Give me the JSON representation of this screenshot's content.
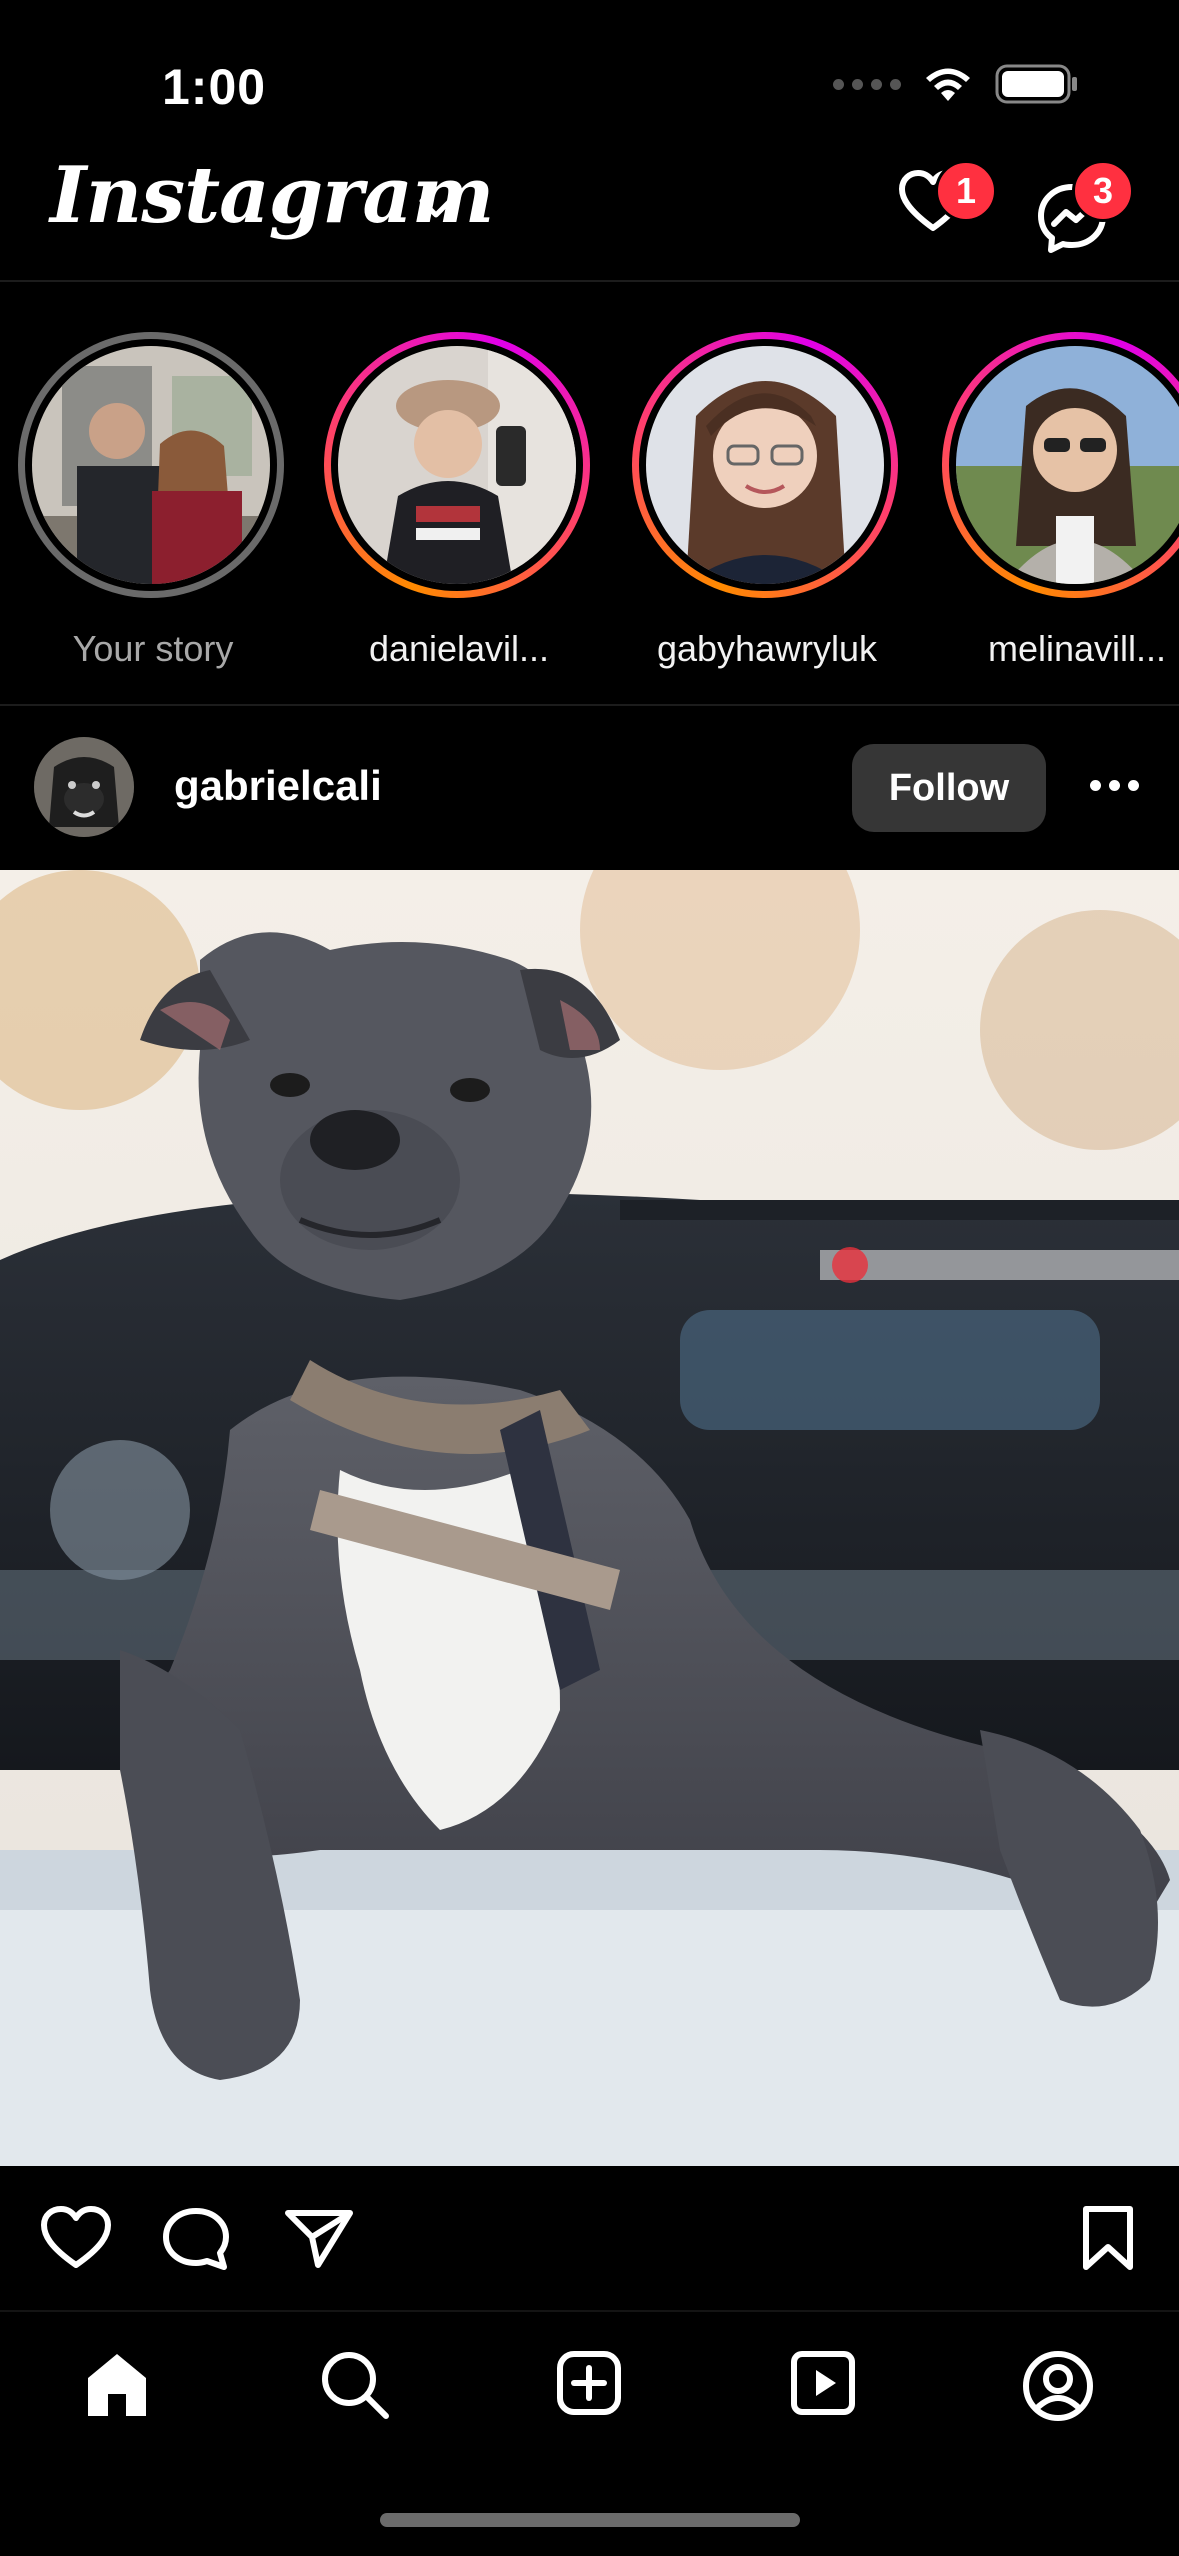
{
  "status_bar": {
    "time": "1:00"
  },
  "header": {
    "logo_text": "Instagram",
    "notifications_count": "1",
    "messages_count": "3"
  },
  "stories": [
    {
      "label": "Your story",
      "seen": true
    },
    {
      "label": "danielavil...",
      "seen": false
    },
    {
      "label": "gabyhawryluk",
      "seen": false
    },
    {
      "label": "melinavill...",
      "seen": false
    }
  ],
  "post": {
    "username": "gabrielcali",
    "follow_label": "Follow"
  },
  "colors": {
    "badge": "#ff3040",
    "follow_button": "#363636",
    "background": "#000000"
  },
  "icons": {
    "nav": [
      "home-icon",
      "search-icon",
      "create-icon",
      "reels-icon",
      "profile-icon"
    ],
    "actions": [
      "heart-icon",
      "comment-icon",
      "share-icon",
      "bookmark-icon"
    ]
  }
}
